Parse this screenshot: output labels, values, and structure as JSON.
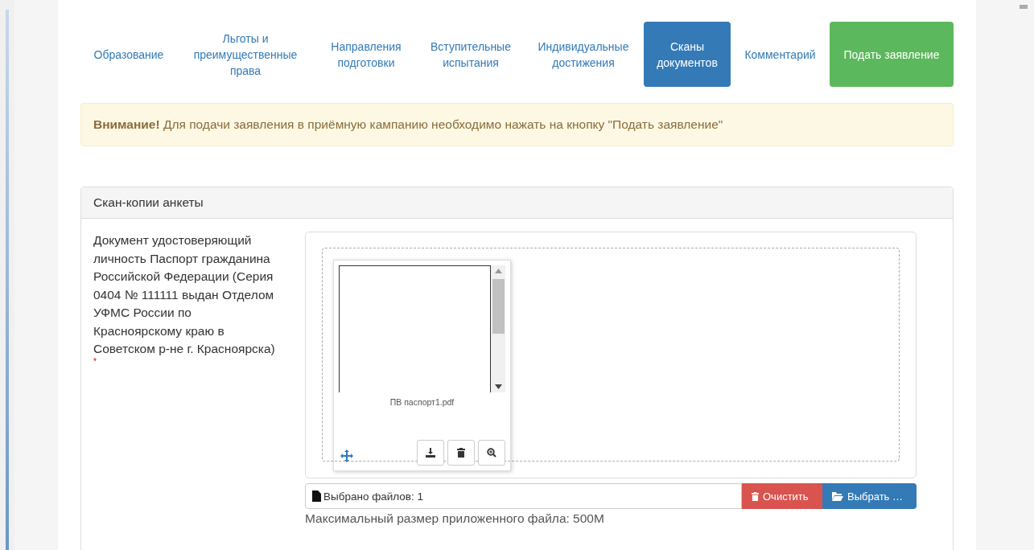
{
  "tabs": [
    {
      "label": "Образование",
      "kind": "tab",
      "selected": false
    },
    {
      "label": "Льготы и преимущественные права",
      "kind": "tab",
      "selected": false
    },
    {
      "label": "Направления подготовки",
      "kind": "tab",
      "selected": false
    },
    {
      "label": "Вступительные испытания",
      "kind": "tab",
      "selected": false
    },
    {
      "label": "Индивидуальные достижения",
      "kind": "tab",
      "selected": false
    },
    {
      "label": "Сканы документов",
      "kind": "tab",
      "selected": true
    },
    {
      "label": "Комментарий",
      "kind": "tab",
      "selected": false
    },
    {
      "label": "Подать заявление",
      "kind": "submit",
      "selected": false
    }
  ],
  "alert": {
    "strong": "Внимание!",
    "text": "Для подачи заявления в приёмную кампанию необходимо нажать на кнопку \"Подать заявление\""
  },
  "panel": {
    "title": "Скан-копии анкеты",
    "field_label": "Документ удостоверяющий личность Паспорт гражданина Российской Федерации (Серия 0404 № 111111 выдан Отделом УФМС России по Красноярскому краю в Советском р-не г. Красноярска)",
    "required_mark": "*",
    "files": [
      {
        "name": "ПВ паспорт1.pdf"
      }
    ],
    "caption": "Выбрано файлов: 1",
    "clear_button": "Очистить",
    "browse_button": "Выбрать …",
    "hint": "Максимальный размер приложенного файла: 500M"
  }
}
